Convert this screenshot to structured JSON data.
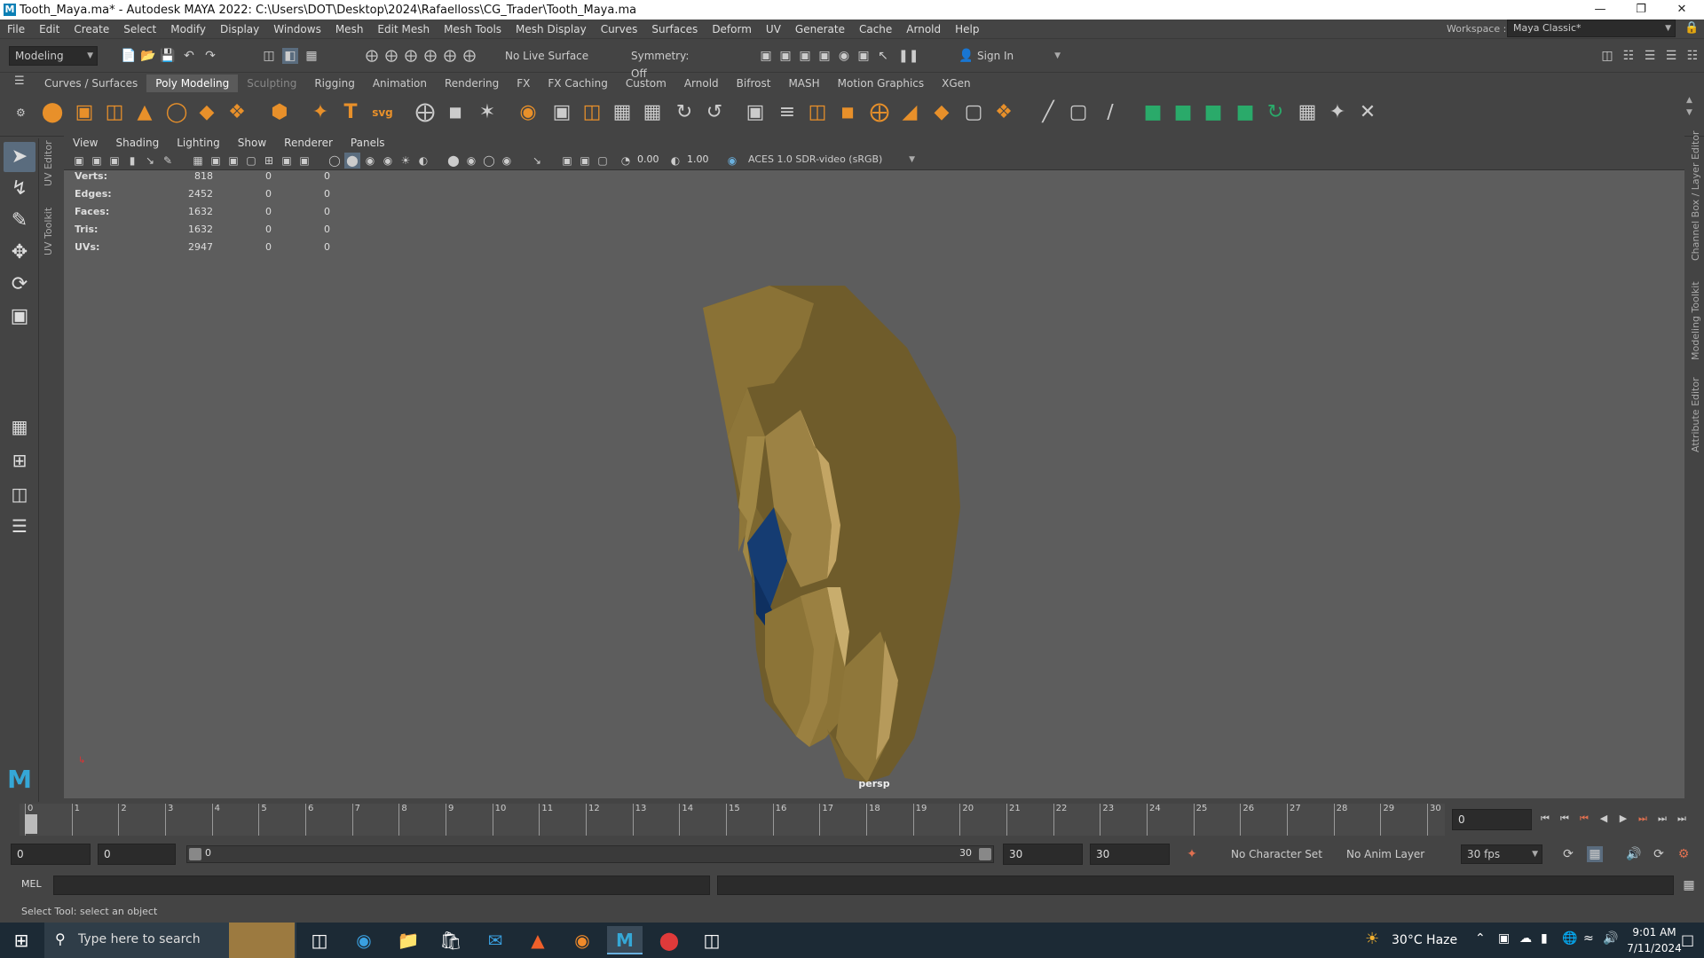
{
  "window": {
    "title": "Tooth_Maya.ma* - Autodesk MAYA 2022: C:\\Users\\DOT\\Desktop\\2024\\Rafaelloss\\CG_Trader\\Tooth_Maya.ma",
    "app_icon": "M"
  },
  "menu": [
    "File",
    "Edit",
    "Create",
    "Select",
    "Modify",
    "Display",
    "Windows",
    "Mesh",
    "Edit Mesh",
    "Mesh Tools",
    "Mesh Display",
    "Curves",
    "Surfaces",
    "Deform",
    "UV",
    "Generate",
    "Cache",
    "Arnold",
    "Help"
  ],
  "status": {
    "mode": "Modeling",
    "live_surface": "No Live Surface",
    "symmetry": "Symmetry: Off",
    "sign_in": "Sign In",
    "workspace_label": "Workspace :",
    "workspace": "Maya Classic*"
  },
  "shelf_tabs": [
    "Curves / Surfaces",
    "Poly Modeling",
    "Sculpting",
    "Rigging",
    "Animation",
    "Rendering",
    "FX",
    "FX Caching",
    "Custom",
    "Arnold",
    "Bifrost",
    "MASH",
    "Motion Graphics",
    "XGen"
  ],
  "shelf_active": "Poly Modeling",
  "viewport_menu": [
    "View",
    "Shading",
    "Lighting",
    "Show",
    "Renderer",
    "Panels"
  ],
  "viewport_toolbar": {
    "exposure": "0.00",
    "gamma": "1.00",
    "color_space": "ACES 1.0 SDR-video (sRGB)"
  },
  "hud": [
    {
      "label": "Verts:",
      "v1": "818",
      "v2": "0",
      "v3": "0"
    },
    {
      "label": "Edges:",
      "v1": "2452",
      "v2": "0",
      "v3": "0"
    },
    {
      "label": "Faces:",
      "v1": "1632",
      "v2": "0",
      "v3": "0"
    },
    {
      "label": "Tris:",
      "v1": "1632",
      "v2": "0",
      "v3": "0"
    },
    {
      "label": "UVs:",
      "v1": "2947",
      "v2": "0",
      "v3": "0"
    }
  ],
  "camera_label": "persp",
  "side_tabs": {
    "uv_editor": "UV Editor",
    "uv_toolkit": "UV Toolkit",
    "channel_box": "Channel Box / Layer Editor",
    "modeling_toolkit": "Modeling Toolkit",
    "attribute_editor": "Attribute Editor"
  },
  "timeline": {
    "ticks": [
      "0",
      "1",
      "2",
      "3",
      "4",
      "5",
      "6",
      "7",
      "8",
      "9",
      "10",
      "11",
      "12",
      "13",
      "14",
      "15",
      "16",
      "17",
      "18",
      "19",
      "20",
      "21",
      "22",
      "23",
      "24",
      "25",
      "26",
      "27",
      "28",
      "29",
      "30"
    ],
    "current_frame": "0"
  },
  "range": {
    "start": "0",
    "anim_start": "0",
    "slider_start": "0",
    "slider_end": "30",
    "end": "30",
    "anim_end": "30",
    "character_set": "No Character Set",
    "anim_layer": "No Anim Layer",
    "fps": "30 fps"
  },
  "cmd": {
    "label": "MEL"
  },
  "help_line": "Select Tool: select an object",
  "taskbar": {
    "search": "Type here to search",
    "weather": "30°C  Haze",
    "time": "9:01 AM",
    "date": "7/11/2024"
  },
  "colors": {
    "tooth": "#8a7336",
    "tooth_dark": "#6a5a28",
    "blue_face": "#123a72"
  }
}
